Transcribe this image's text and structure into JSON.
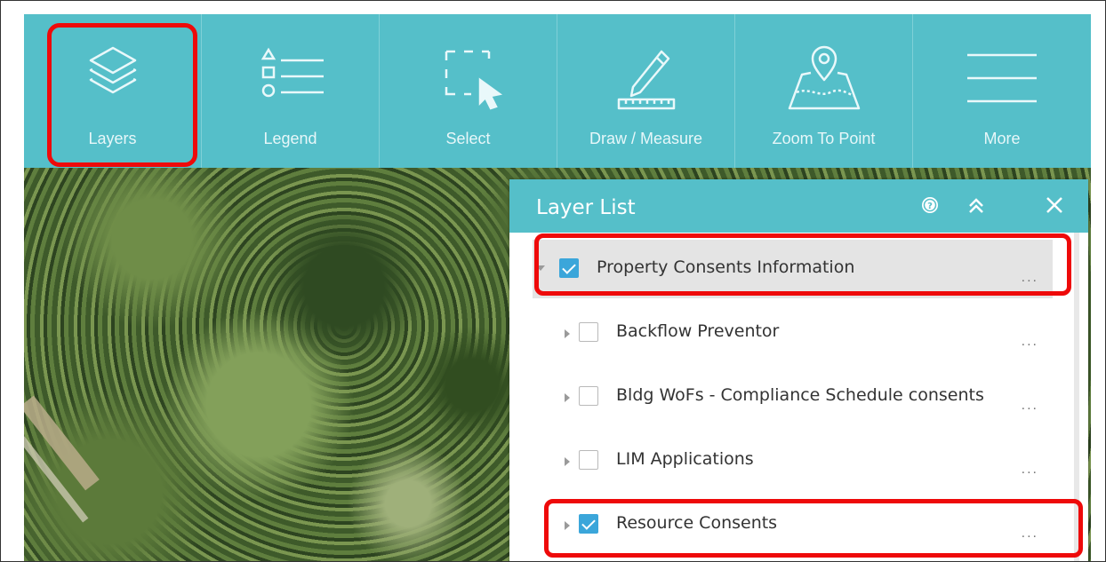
{
  "toolbar": {
    "items": [
      {
        "label": "Layers",
        "icon": "layers-icon"
      },
      {
        "label": "Legend",
        "icon": "legend-icon"
      },
      {
        "label": "Select",
        "icon": "select-icon"
      },
      {
        "label": "Draw / Measure",
        "icon": "draw-measure-icon"
      },
      {
        "label": "Zoom To Point",
        "icon": "zoom-to-point-icon"
      },
      {
        "label": "More",
        "icon": "menu-icon"
      }
    ]
  },
  "layer_list": {
    "title": "Layer List",
    "header_icons": [
      "help-icon",
      "collapse-icon",
      "close-icon"
    ],
    "items": [
      {
        "label": "Property Consents Information",
        "checked": true,
        "expanded": true,
        "selected": true,
        "more": "..."
      },
      {
        "label": "Backflow Preventor",
        "checked": false,
        "more": "..."
      },
      {
        "label": "Bldg WoFs - Compliance Schedule consents",
        "checked": false,
        "more": "..."
      },
      {
        "label": "LIM Applications",
        "checked": false,
        "more": "..."
      },
      {
        "label": "Resource Consents",
        "checked": true,
        "more": "..."
      }
    ]
  },
  "colors": {
    "toolbar": "#55bfc9",
    "highlight": "#ee0a0a",
    "checkbox": "#3ba6da"
  }
}
